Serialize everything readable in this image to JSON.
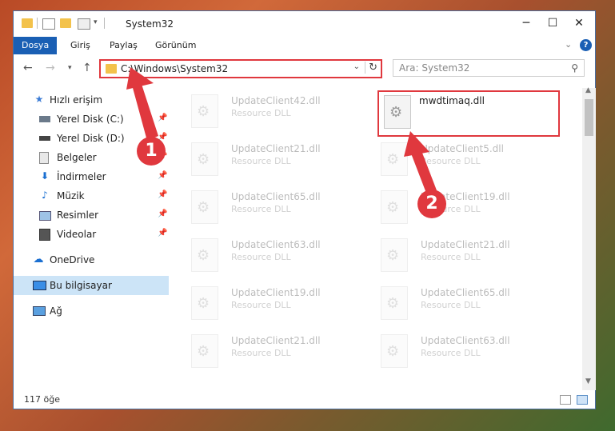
{
  "window": {
    "title": "System32",
    "controls": {
      "minimize": "─",
      "maximize": "☐",
      "close": "✕"
    }
  },
  "ribbon": {
    "tabs": [
      {
        "label": "Dosya",
        "active": true
      },
      {
        "label": "Giriş",
        "active": false
      },
      {
        "label": "Paylaş",
        "active": false
      },
      {
        "label": "Görünüm",
        "active": false
      }
    ]
  },
  "address": {
    "path": "C:\\Windows\\System32",
    "search_placeholder": "Ara: System32"
  },
  "sidebar": {
    "items": [
      {
        "label": "Hızlı erişim",
        "icon": "star-icon",
        "pinned": false,
        "selected": false
      },
      {
        "label": "Yerel Disk (C:)",
        "icon": "drive-icon",
        "pinned": true,
        "selected": false
      },
      {
        "label": "Yerel Disk (D:)",
        "icon": "drive-icon",
        "pinned": true,
        "selected": false
      },
      {
        "label": "Belgeler",
        "icon": "documents-icon",
        "pinned": true,
        "selected": false
      },
      {
        "label": "İndirmeler",
        "icon": "download-icon",
        "pinned": true,
        "selected": false
      },
      {
        "label": "Müzik",
        "icon": "music-icon",
        "pinned": true,
        "selected": false
      },
      {
        "label": "Resimler",
        "icon": "pictures-icon",
        "pinned": true,
        "selected": false
      },
      {
        "label": "Videolar",
        "icon": "videos-icon",
        "pinned": true,
        "selected": false
      },
      {
        "label": "OneDrive",
        "icon": "cloud-icon",
        "pinned": false,
        "selected": false
      },
      {
        "label": "Bu bilgisayar",
        "icon": "computer-icon",
        "pinned": false,
        "selected": true
      },
      {
        "label": "Ağ",
        "icon": "network-icon",
        "pinned": false,
        "selected": false
      }
    ]
  },
  "files": {
    "left_column": [
      {
        "name": "UpdateClient42.dll",
        "type": "Resource DLL"
      },
      {
        "name": "UpdateClient21.dll",
        "type": "Resource DLL"
      },
      {
        "name": "UpdateClient65.dll",
        "type": "Resource DLL"
      },
      {
        "name": "UpdateClient63.dll",
        "type": "Resource DLL"
      },
      {
        "name": "UpdateClient19.dll",
        "type": "Resource DLL"
      },
      {
        "name": "UpdateClient21.dll",
        "type": "Resource DLL"
      }
    ],
    "right_column": [
      {
        "name": "mwdtimaq.dll",
        "type": "",
        "highlighted": true
      },
      {
        "name": "UpdateClient5.dll",
        "type": "Resource DLL"
      },
      {
        "name": "UpdateClient19.dll",
        "type": "Resource DLL"
      },
      {
        "name": "UpdateClient21.dll",
        "type": "Resource DLL"
      },
      {
        "name": "UpdateClient65.dll",
        "type": "Resource DLL"
      },
      {
        "name": "UpdateClient63.dll",
        "type": "Resource DLL"
      }
    ]
  },
  "status": {
    "count": "117 öğe"
  },
  "annotations": {
    "badge1": "1",
    "badge2": "2",
    "color": "#e0383e"
  }
}
